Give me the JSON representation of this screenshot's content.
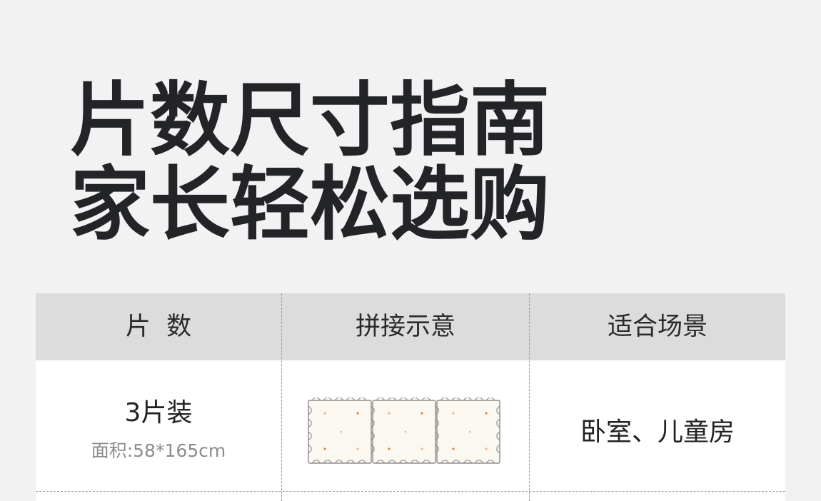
{
  "headline": {
    "line1": "片数尺寸指南",
    "line2": "家长轻松选购"
  },
  "table": {
    "headers": [
      "片  数",
      "拼接示意",
      "适合场景"
    ],
    "rows": [
      {
        "quantity": "3片装",
        "area": "面积:58*165cm",
        "diagram": "three-interlocking-mats",
        "scene": "卧室、儿童房"
      }
    ]
  },
  "colors": {
    "background": "#f2f2f2",
    "header_bg": "#dcdcdc",
    "headline": "#222428",
    "dot_orange": "#e8823a",
    "dot_peach": "#f2b48a"
  }
}
